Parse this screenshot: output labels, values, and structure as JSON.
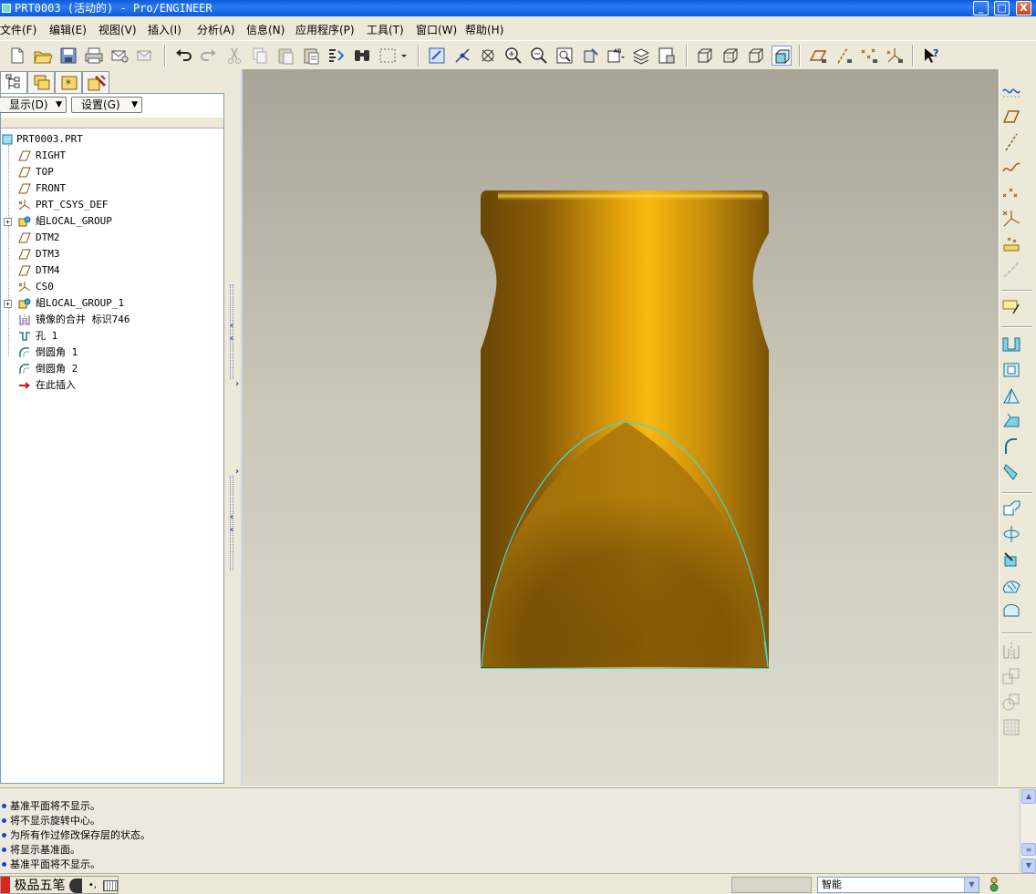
{
  "window": {
    "title": "PRT0003 (活动的) - Pro/ENGINEER",
    "controls": {
      "minimize": "_",
      "maximize": "□",
      "close": "X"
    }
  },
  "menu": [
    {
      "label": "文件(F)"
    },
    {
      "label": "编辑(E)"
    },
    {
      "label": "视图(V)"
    },
    {
      "label": "插入(I)"
    },
    {
      "label": "分析(A)"
    },
    {
      "label": "信息(N)"
    },
    {
      "label": "应用程序(P)"
    },
    {
      "label": "工具(T)"
    },
    {
      "label": "窗口(W)"
    },
    {
      "label": "帮助(H)"
    }
  ],
  "toolbar_icons": [
    "new-file-icon",
    "open-folder-icon",
    "save-icon",
    "print-icon",
    "send-mail-icon",
    "email-icon",
    "undo-icon",
    "redo-icon",
    "cut-icon",
    "copy-icon",
    "paste-icon",
    "paste-special-icon",
    "regenerate-icon",
    "find-icon",
    "select-box-icon",
    "repaint-icon",
    "spin-center-icon",
    "orient-icon",
    "zoom-in-icon",
    "zoom-out-icon",
    "refit-icon",
    "reorient-icon",
    "saved-views-icon",
    "layers-icon",
    "view-manager-icon",
    "wireframe-icon",
    "hidden-line-icon",
    "no-hidden-icon",
    "shading-icon",
    "datum-planes-icon",
    "datum-axes-icon",
    "datum-points-icon",
    "csys-icon",
    "whats-this-icon"
  ],
  "left_panel": {
    "tabs": [
      "model-tree-tab",
      "layers-tab",
      "favorites-tab",
      "tools-tab"
    ],
    "show_button": "显示(D)",
    "settings_button": "设置(G)",
    "tree": [
      {
        "label": "PRT0003.PRT",
        "icon": "part-icon",
        "level": 0,
        "expandable": false
      },
      {
        "label": "RIGHT",
        "icon": "datum-plane-icon",
        "level": 1,
        "expandable": false
      },
      {
        "label": "TOP",
        "icon": "datum-plane-icon",
        "level": 1,
        "expandable": false
      },
      {
        "label": "FRONT",
        "icon": "datum-plane-icon",
        "level": 1,
        "expandable": false
      },
      {
        "label": "PRT_CSYS_DEF",
        "icon": "csys-icon",
        "level": 1,
        "expandable": false
      },
      {
        "label": "組LOCAL_GROUP",
        "icon": "group-icon",
        "level": 1,
        "expandable": true
      },
      {
        "label": "DTM2",
        "icon": "datum-plane-icon",
        "level": 1,
        "expandable": false
      },
      {
        "label": "DTM3",
        "icon": "datum-plane-icon",
        "level": 1,
        "expandable": false
      },
      {
        "label": "DTM4",
        "icon": "datum-plane-icon",
        "level": 1,
        "expandable": false
      },
      {
        "label": "CS0",
        "icon": "csys-icon",
        "level": 1,
        "expandable": false
      },
      {
        "label": "組LOCAL_GROUP_1",
        "icon": "group-icon",
        "level": 1,
        "expandable": true
      },
      {
        "label": "镜像的合并 标识746",
        "icon": "mirror-merge-icon",
        "level": 1,
        "expandable": false
      },
      {
        "label": "孔 1",
        "icon": "hole-icon",
        "level": 1,
        "expandable": false
      },
      {
        "label": "倒圆角 1",
        "icon": "round-icon",
        "level": 1,
        "expandable": false
      },
      {
        "label": "倒圆角 2",
        "icon": "round-icon",
        "level": 1,
        "expandable": false
      },
      {
        "label": "在此插入",
        "icon": "insert-here-arrow-icon",
        "level": 1,
        "expandable": false
      }
    ]
  },
  "right_tools": [
    "datum-plane-display-icon",
    "datum-plane-tool-icon",
    "datum-axis-tool-icon",
    "datum-curve-tool-icon",
    "datum-point-tool-icon",
    "csys-tool-icon",
    "analysis-feature-icon",
    "sketch-tool-icon",
    "extrude-icon",
    "revolve-icon",
    "variable-section-sweep-icon",
    "boundary-blend-icon",
    "style-icon",
    "hole-icon",
    "shell-icon",
    "rib-icon",
    "draft-icon",
    "round-icon",
    "chamfer-icon",
    "copy-icon",
    "mirror-icon",
    "move-icon",
    "trim-icon",
    "extend-icon",
    "offset-icon",
    "thicken-icon",
    "solidify-icon",
    "pattern-icon"
  ],
  "colors": {
    "model_light": "#f5b50f",
    "model_dark": "#6d4a05",
    "highlight_edge": "#3fd9d9",
    "bullet": "#1d3fd6"
  },
  "messages": [
    "基准平面将不显示。",
    "将不显示旋转中心。",
    "为所有作过修改保存层的状态。",
    "将显示基准面。",
    "基准平面将不显示。"
  ],
  "status": {
    "ime_label": "极品五笔",
    "filter_value": "智能"
  }
}
